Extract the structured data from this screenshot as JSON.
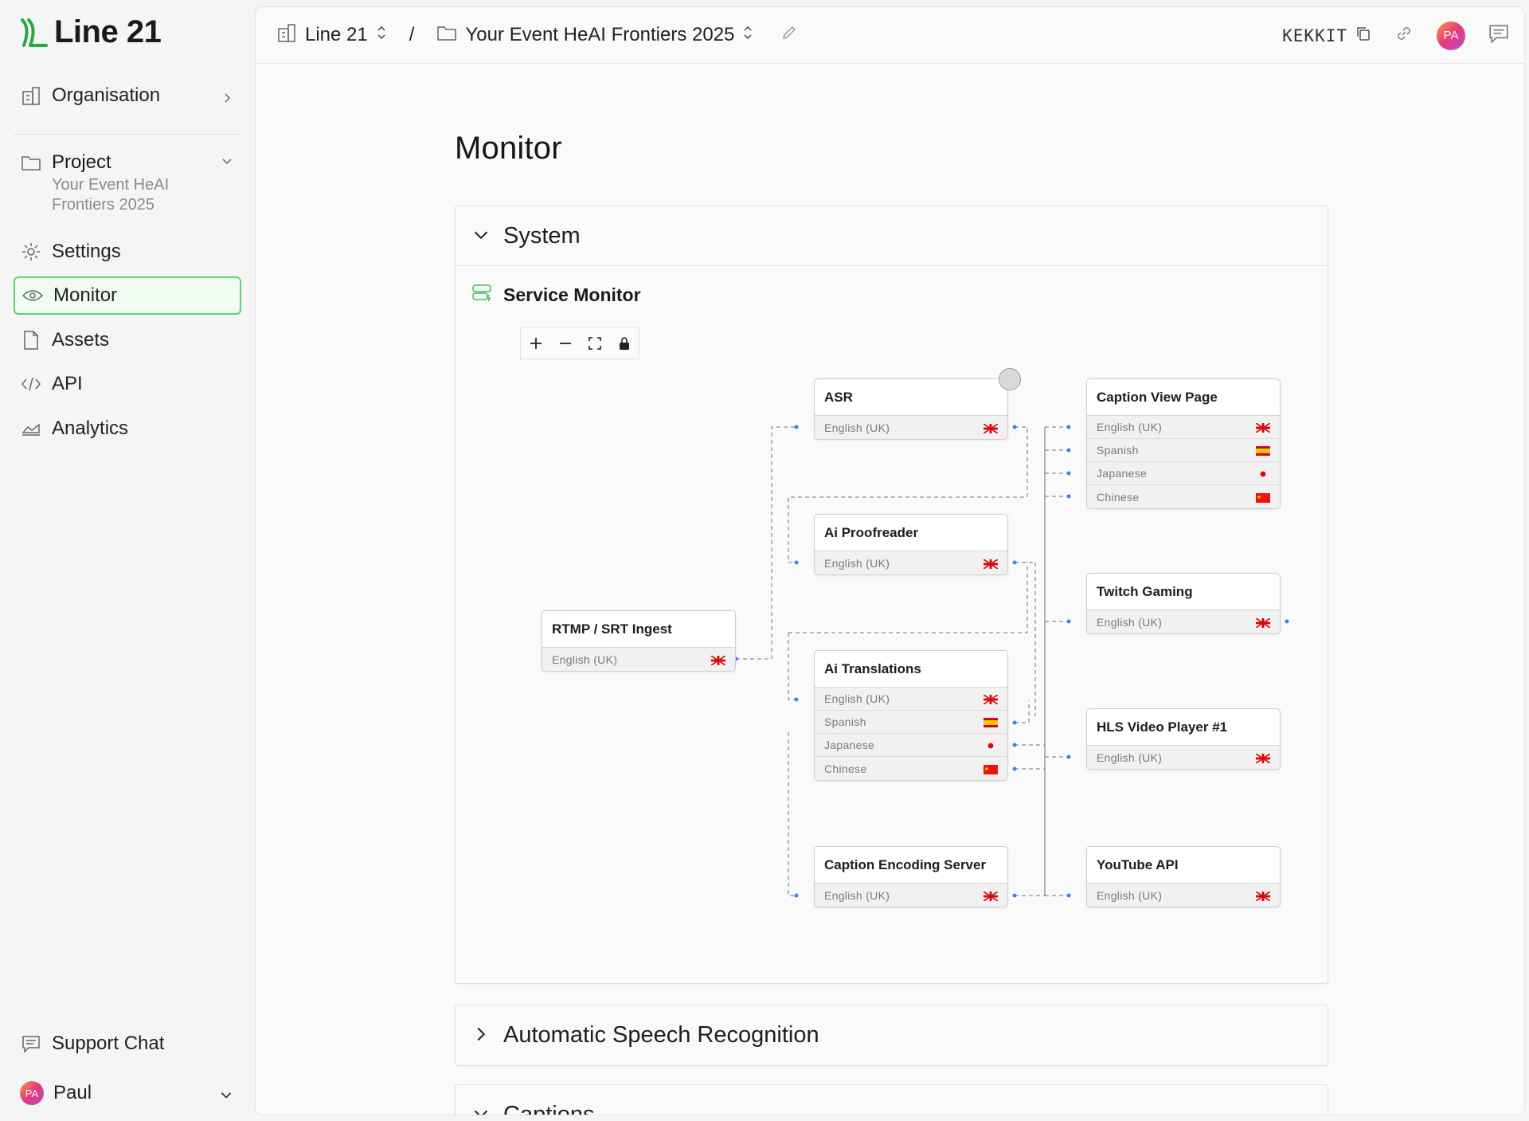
{
  "app": {
    "name": "Line 21"
  },
  "sidebar": {
    "organisation": "Organisation",
    "project": {
      "label": "Project",
      "name": "Your Event HeAI Frontiers 2025"
    },
    "items": [
      "Settings",
      "Monitor",
      "Assets",
      "API",
      "Analytics"
    ],
    "support": "Support Chat",
    "user": {
      "name": "Paul",
      "initials": "PA"
    }
  },
  "topbar": {
    "org": "Line 21",
    "separator": "/",
    "project": "Your Event HeAI Frontiers 2025",
    "code": "KEKKIT",
    "avatar": "PA"
  },
  "page": {
    "title": "Monitor"
  },
  "sections": {
    "system": "System",
    "service_monitor": "Service Monitor",
    "asr": "Automatic Speech Recognition",
    "captions": "Captions"
  },
  "nodes": {
    "rtmp": {
      "title": "RTMP / SRT Ingest",
      "rows": [
        {
          "lang": "English (UK)",
          "flag": "uk"
        }
      ]
    },
    "asr": {
      "title": "ASR",
      "rows": [
        {
          "lang": "English (UK)",
          "flag": "uk"
        }
      ]
    },
    "proof": {
      "title": "Ai Proofreader",
      "rows": [
        {
          "lang": "English (UK)",
          "flag": "uk"
        }
      ]
    },
    "trans": {
      "title": "Ai Translations",
      "rows": [
        {
          "lang": "English (UK)",
          "flag": "uk"
        },
        {
          "lang": "Spanish",
          "flag": "es"
        },
        {
          "lang": "Japanese",
          "flag": "jp"
        },
        {
          "lang": "Chinese",
          "flag": "cn"
        }
      ]
    },
    "encoder": {
      "title": "Caption Encoding Server",
      "rows": [
        {
          "lang": "English (UK)",
          "flag": "uk"
        }
      ]
    },
    "view": {
      "title": "Caption View Page",
      "rows": [
        {
          "lang": "English (UK)",
          "flag": "uk"
        },
        {
          "lang": "Spanish",
          "flag": "es"
        },
        {
          "lang": "Japanese",
          "flag": "jp"
        },
        {
          "lang": "Chinese",
          "flag": "cn"
        }
      ]
    },
    "twitch": {
      "title": "Twitch Gaming",
      "rows": [
        {
          "lang": "English (UK)",
          "flag": "uk"
        }
      ]
    },
    "hls": {
      "title": "HLS Video Player #1",
      "rows": [
        {
          "lang": "English (UK)",
          "flag": "uk"
        }
      ]
    },
    "youtube": {
      "title": "YouTube API",
      "rows": [
        {
          "lang": "English (UK)",
          "flag": "uk"
        }
      ]
    }
  },
  "colors": {
    "accent": "#3fbf55",
    "active_border": "#5ed36b",
    "handle": "#3b82f6",
    "edge": "#8e8e8e"
  }
}
